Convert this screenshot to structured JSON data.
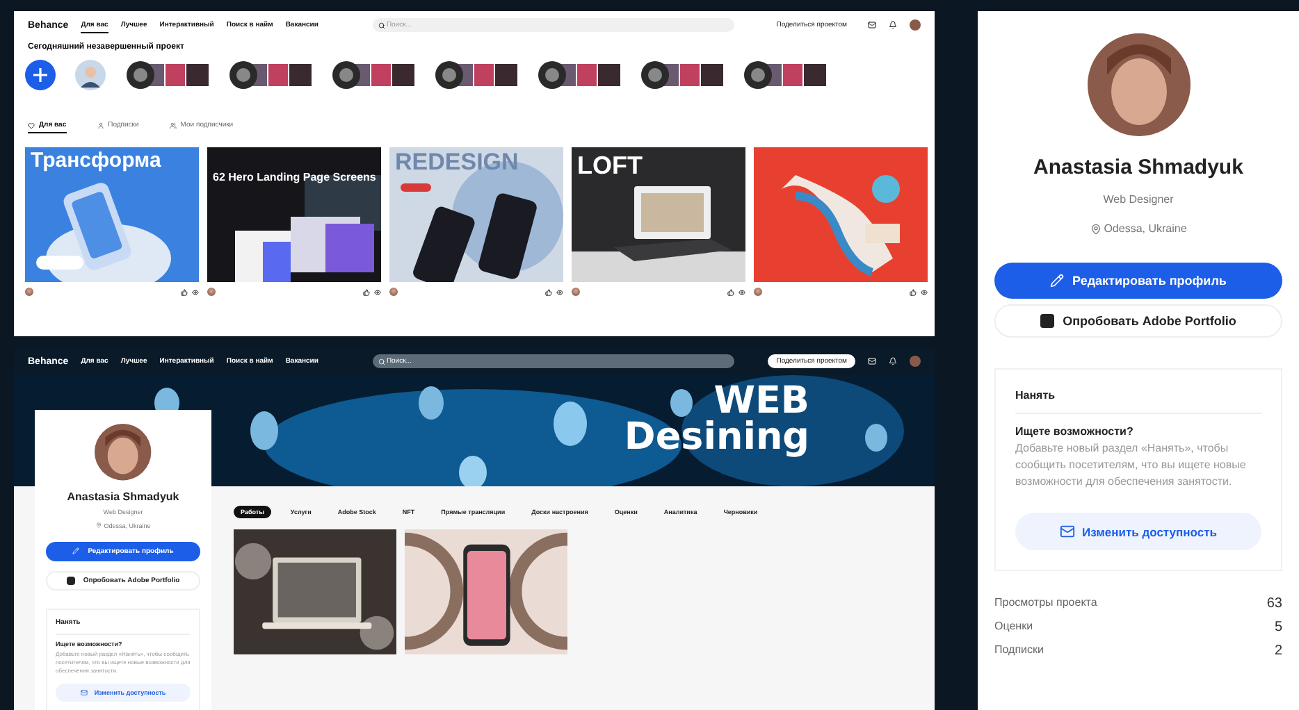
{
  "feed_screen": {
    "nav": {
      "logo": "Behance",
      "links": [
        {
          "label": "Для вас",
          "selected": true
        },
        {
          "label": "Лучшее",
          "selected": false
        },
        {
          "label": "Интерактивный",
          "selected": false
        },
        {
          "label": "Поиск в найм",
          "selected": false
        },
        {
          "label": "Вакансии",
          "selected": false
        }
      ],
      "search": {
        "placeholder": "Поиск..."
      },
      "share": "Поделиться проектом"
    },
    "heading": "Сегодняшний незавершенный проект",
    "stories": [
      {
        "kind": "add"
      },
      {
        "kind": "person"
      },
      {
        "kind": "group"
      },
      {
        "kind": "group"
      },
      {
        "kind": "group"
      },
      {
        "kind": "group"
      },
      {
        "kind": "group"
      },
      {
        "kind": "group"
      },
      {
        "kind": "group"
      }
    ],
    "tabs": [
      {
        "label": "Для вас",
        "selected": true
      },
      {
        "label": "Подписки",
        "selected": false
      },
      {
        "label": "Мои подписчики",
        "selected": false
      }
    ],
    "cards": [
      {
        "kind": "phone-hand",
        "title": "Трансформа"
      },
      {
        "kind": "landing",
        "title": "62 Hero Landing Page Screens"
      },
      {
        "kind": "phones",
        "title": "REDESIGN"
      },
      {
        "kind": "laptop",
        "title": "LOFT"
      },
      {
        "kind": "illustration"
      }
    ]
  },
  "profile_screen": {
    "nav": {
      "logo": "Behance",
      "links": [
        {
          "label": "Для вас",
          "selected": false
        },
        {
          "label": "Лучшее",
          "selected": false
        },
        {
          "label": "Интерактивный",
          "selected": false
        },
        {
          "label": "Поиск в найм",
          "selected": false
        },
        {
          "label": "Вакансии",
          "selected": false
        }
      ],
      "search": {
        "placeholder": "Поиск..."
      },
      "share": "Поделиться проектом"
    },
    "banner": {
      "line1": "WEB",
      "line2": "Desining"
    },
    "card": {
      "name": "Anastasia Shmadyuk",
      "role": "Web Designer",
      "location": "Odessa, Ukraine",
      "edit_button": "Редактировать профиль",
      "portfolio_button": "Опробовать Adobe Portfolio",
      "hire": {
        "title": "Нанять",
        "question": "Ищете возможности?",
        "text": "Добавьте новый раздел «Нанять», чтобы сообщить посетителям, что вы ищете новые возможности для обеспечения занятости.",
        "button": "Изменить доступность"
      }
    },
    "tabs": [
      {
        "label": "Работы",
        "selected": true
      },
      {
        "label": "Услуги",
        "selected": false
      },
      {
        "label": "Adobe Stock",
        "selected": false
      },
      {
        "label": "NFT",
        "selected": false
      },
      {
        "label": "Прямые трансляции",
        "selected": false
      },
      {
        "label": "Доски настроения",
        "selected": false
      },
      {
        "label": "Оценки",
        "selected": false
      },
      {
        "label": "Аналитика",
        "selected": false
      },
      {
        "label": "Черновики",
        "selected": false
      }
    ],
    "projects": [
      {
        "kind": "laptop-sketch"
      },
      {
        "kind": "phone-rings"
      }
    ]
  },
  "sidebar": {
    "name": "Anastasia Shmadyuk",
    "role": "Web Designer",
    "location": "Odessa, Ukraine",
    "edit_button": "Редактировать профиль",
    "portfolio_button": "Опробовать Adobe Portfolio",
    "hire": {
      "title": "Нанять",
      "question": "Ищете возможности?",
      "text": "Добавьте новый раздел «Нанять», чтобы сообщить посетителям, что вы ищете новые возможности для обеспечения занятости.",
      "button": "Изменить доступность"
    },
    "stats": [
      {
        "label": "Просмотры проекта",
        "value": "63"
      },
      {
        "label": "Оценки",
        "value": "5"
      },
      {
        "label": "Подписки",
        "value": "2"
      }
    ]
  }
}
